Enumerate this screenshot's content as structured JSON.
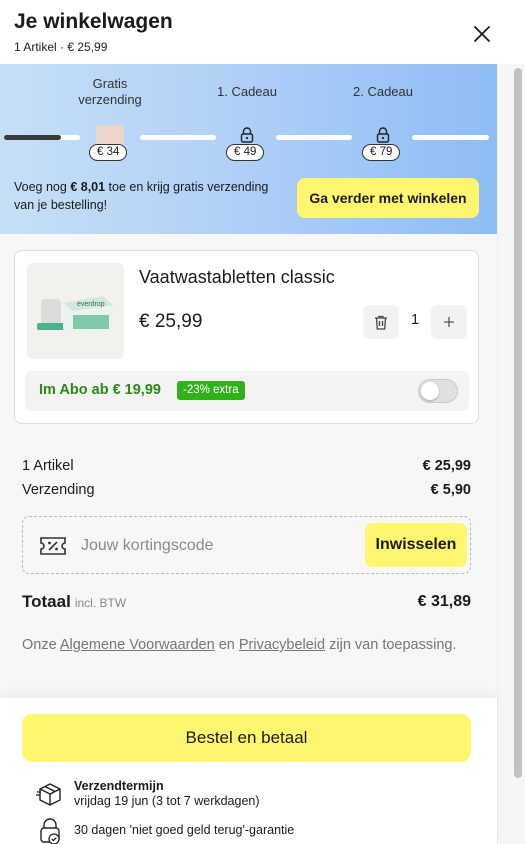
{
  "header": {
    "title": "Je winkelwagen",
    "subtitle": "1 Artikel · € 25,99"
  },
  "shipping_progress": {
    "milestones": [
      {
        "label": "Gratis verzending",
        "price": "€ 34"
      },
      {
        "label": "1. Cadeau",
        "price": "€ 49"
      },
      {
        "label": "2. Cadeau",
        "price": "€ 79"
      }
    ],
    "progress_first_segment": 0.75,
    "promo_prefix": "Voeg nog ",
    "promo_amount": "€ 8,01",
    "promo_suffix": " toe en krijg gratis verzending van je bestelling!",
    "continue_label": "Ga verder met winkelen"
  },
  "cart_item": {
    "name": "Vaatwastabletten classic",
    "price": "€ 25,99",
    "quantity": "1",
    "image_brand_text": "everdrop",
    "subscription_label": "Im Abo ab € 19,99",
    "subscription_badge": "-23% extra",
    "subscription_enabled": false
  },
  "summary": {
    "items_label": "1 Artikel",
    "items_value": "€ 25,99",
    "shipping_label": "Verzending",
    "shipping_value": "€ 5,90"
  },
  "coupon": {
    "placeholder": "Jouw kortingscode",
    "redeem_label": "Inwisselen"
  },
  "total": {
    "label": "Totaal",
    "suffix": "incl. BTW",
    "value": "€ 31,89"
  },
  "terms": {
    "prefix": "Onze ",
    "link1": "Algemene Voorwaarden",
    "middle": " en ",
    "link2": "Privacybeleid",
    "suffix": " zijn van toepassing."
  },
  "footer": {
    "order_label": "Bestel en betaal",
    "delivery_title": "Verzendtermijn",
    "delivery_text": "vrijdag 19 jun (3 tot 7 werkdagen)",
    "guarantee_text": "30 dagen 'niet goed geld terug'-garantie"
  },
  "colors": {
    "accent_yellow": "#fff66f",
    "abo_green": "#2b8a17",
    "badge_green": "#31b01c",
    "banner_blue": "#8ebcf5"
  }
}
